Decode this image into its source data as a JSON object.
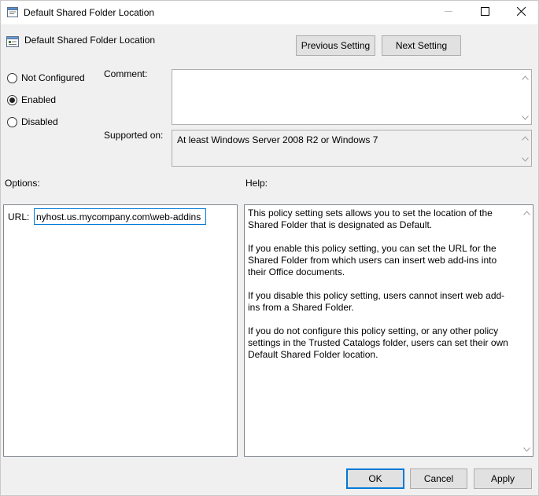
{
  "window": {
    "title": "Default Shared Folder Location",
    "controls": {
      "minimize": "minimize-icon",
      "maximize": "maximize-icon",
      "close": "close-icon"
    }
  },
  "header": {
    "title": "Default Shared Folder Location",
    "previous_label": "Previous Setting",
    "next_label": "Next Setting"
  },
  "state": {
    "options": [
      {
        "label": "Not Configured",
        "selected": false
      },
      {
        "label": "Enabled",
        "selected": true
      },
      {
        "label": "Disabled",
        "selected": false
      }
    ]
  },
  "comment": {
    "label": "Comment:",
    "value": ""
  },
  "supported": {
    "label": "Supported on:",
    "value": "At least Windows Server 2008 R2 or Windows 7"
  },
  "options": {
    "label": "Options:",
    "url_label": "URL:",
    "url_value": "nyhost.us.mycompany.com\\web-addins"
  },
  "help": {
    "label": "Help:",
    "paragraphs": [
      "This policy setting sets allows you to set the location of the Shared Folder that is designated as Default.",
      "If you enable this policy setting, you can set the URL for the Shared Folder from which users can insert web add-ins into their Office documents.",
      "If you disable this policy setting, users cannot insert web add-ins from a Shared Folder.",
      "If you do not configure this policy setting, or any other policy settings in the Trusted Catalogs folder, users can set their own Default Shared Folder location."
    ]
  },
  "footer": {
    "ok_label": "OK",
    "cancel_label": "Cancel",
    "apply_label": "Apply"
  },
  "colors": {
    "accent": "#0078d7",
    "window_bg": "#f0f0f0",
    "button_bg": "#e1e1e1"
  }
}
